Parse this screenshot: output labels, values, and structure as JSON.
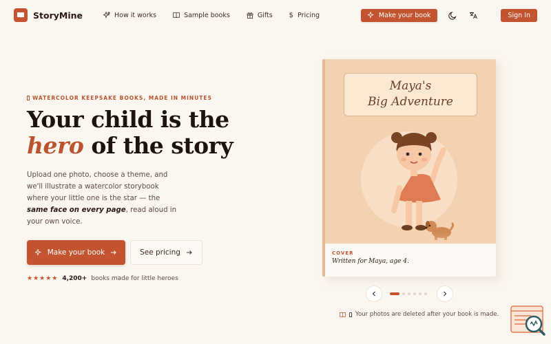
{
  "brand": {
    "name": "StoryMine"
  },
  "nav": {
    "links": [
      {
        "label": "How it works",
        "icon": "sparkle-icon"
      },
      {
        "label": "Sample books",
        "icon": "book-open-icon"
      },
      {
        "label": "Gifts",
        "icon": "gift-icon"
      },
      {
        "label": "Pricing",
        "icon": "dollar-icon"
      }
    ],
    "make_book": "Make your book",
    "sign_in": "Sign In"
  },
  "hero": {
    "eyebrow": "WATERCOLOR KEEPSAKE BOOKS, MADE IN MINUTES",
    "title_pre": "Your child is the ",
    "title_accent": "hero",
    "title_post": " of the story",
    "desc_pre": "Upload one photo, choose a theme, and we'll illustrate a watercolor storybook where your little one is the star — the ",
    "desc_bold": "same face on every page",
    "desc_post": ", read aloud in your own voice.",
    "cta_primary": "Make your book",
    "cta_secondary": "See pricing",
    "rating_stars": "★★★★★",
    "rating_count": "4,200+",
    "rating_text": "books made for little heroes"
  },
  "book": {
    "title_line1": "Maya's",
    "title_line2": "Big Adventure",
    "footer_label": "COVER",
    "footer_text": "Written for Maya, age 4."
  },
  "carousel": {
    "page_count": 6,
    "active": 0
  },
  "privacy_note": "Your photos are deleted after your book is made.",
  "colors": {
    "accent": "#c4532f",
    "background": "#fbf6ef"
  }
}
